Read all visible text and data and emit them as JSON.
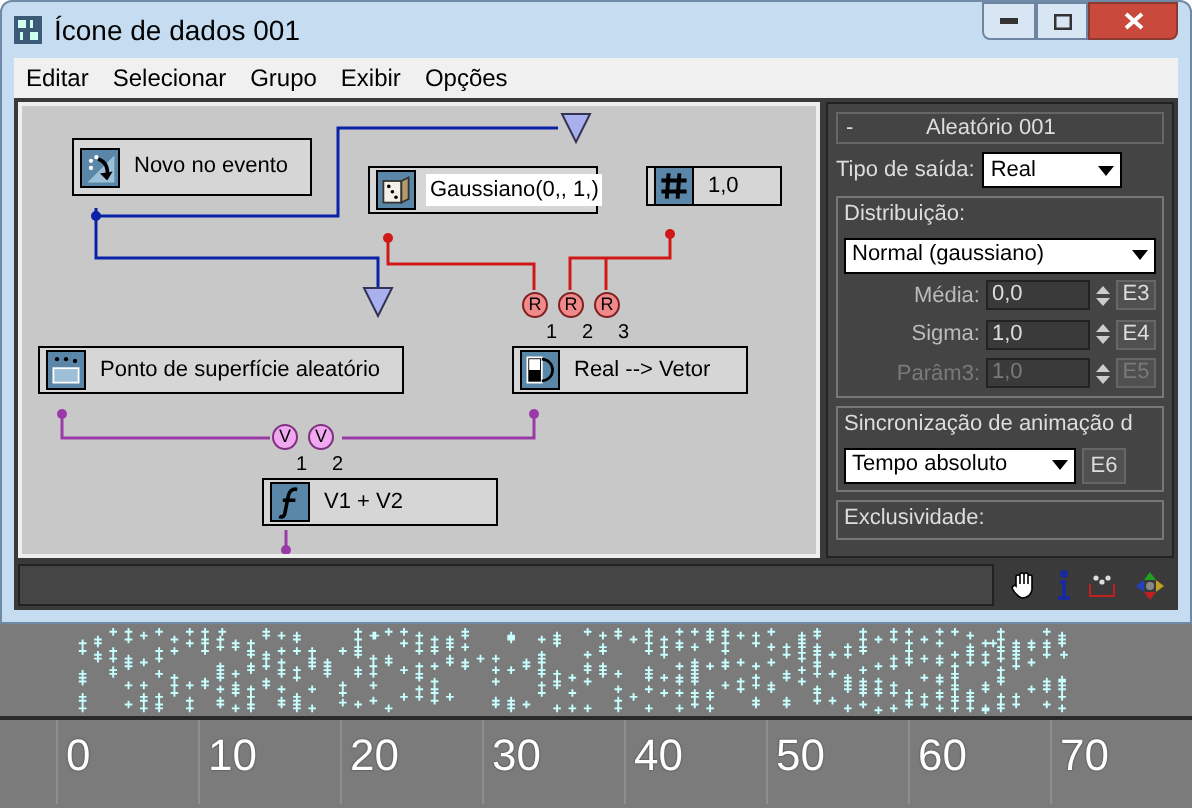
{
  "window": {
    "title": "Ícone de dados 001"
  },
  "menu": [
    {
      "label": "Editar"
    },
    {
      "label": "Selecionar"
    },
    {
      "label": "Grupo"
    },
    {
      "label": "Exibir"
    },
    {
      "label": "Opções"
    }
  ],
  "nodes": [
    {
      "label": "Novo no evento",
      "kind": "event",
      "selected": false
    },
    {
      "label": "Gaussiano(0,, 1,)",
      "kind": "dice",
      "selected": true
    },
    {
      "label": "1,0",
      "kind": "hash",
      "selected": false
    },
    {
      "label": "Ponto de superfície aleatório",
      "kind": "surface",
      "selected": false
    },
    {
      "label": "Real --> Vetor",
      "kind": "converter",
      "selected": false
    },
    {
      "label": "V1 + V2",
      "kind": "function",
      "selected": false
    }
  ],
  "real_inputs": [
    {
      "letter": "R",
      "number": "1"
    },
    {
      "letter": "R",
      "number": "2"
    },
    {
      "letter": "R",
      "number": "3"
    }
  ],
  "vector_inputs": [
    {
      "letter": "V",
      "number": "1"
    },
    {
      "letter": "V",
      "number": "2"
    }
  ],
  "panel": {
    "title": "Aleatório 001",
    "collapse": "-",
    "output_type": {
      "label": "Tipo de saída:",
      "value": "Real"
    },
    "distribution": {
      "label": "Distribuição:",
      "value": "Normal (gaussiano)",
      "params": [
        {
          "label": "Média:",
          "value": "0,0",
          "button": "E3",
          "disabled": false
        },
        {
          "label": "Sigma:",
          "value": "1,0",
          "button": "E4",
          "disabled": false
        },
        {
          "label": "Parâm3:",
          "value": "1,0",
          "button": "E5",
          "disabled": true
        }
      ]
    },
    "sync": {
      "label": "Sincronização de animação d",
      "value": "Tempo absoluto",
      "button": "E6"
    },
    "exclusivity": {
      "label": "Exclusividade:"
    }
  },
  "viewport": {
    "ruler_labels": [
      "0",
      "10",
      "20",
      "30",
      "40",
      "50",
      "60",
      "70"
    ]
  }
}
